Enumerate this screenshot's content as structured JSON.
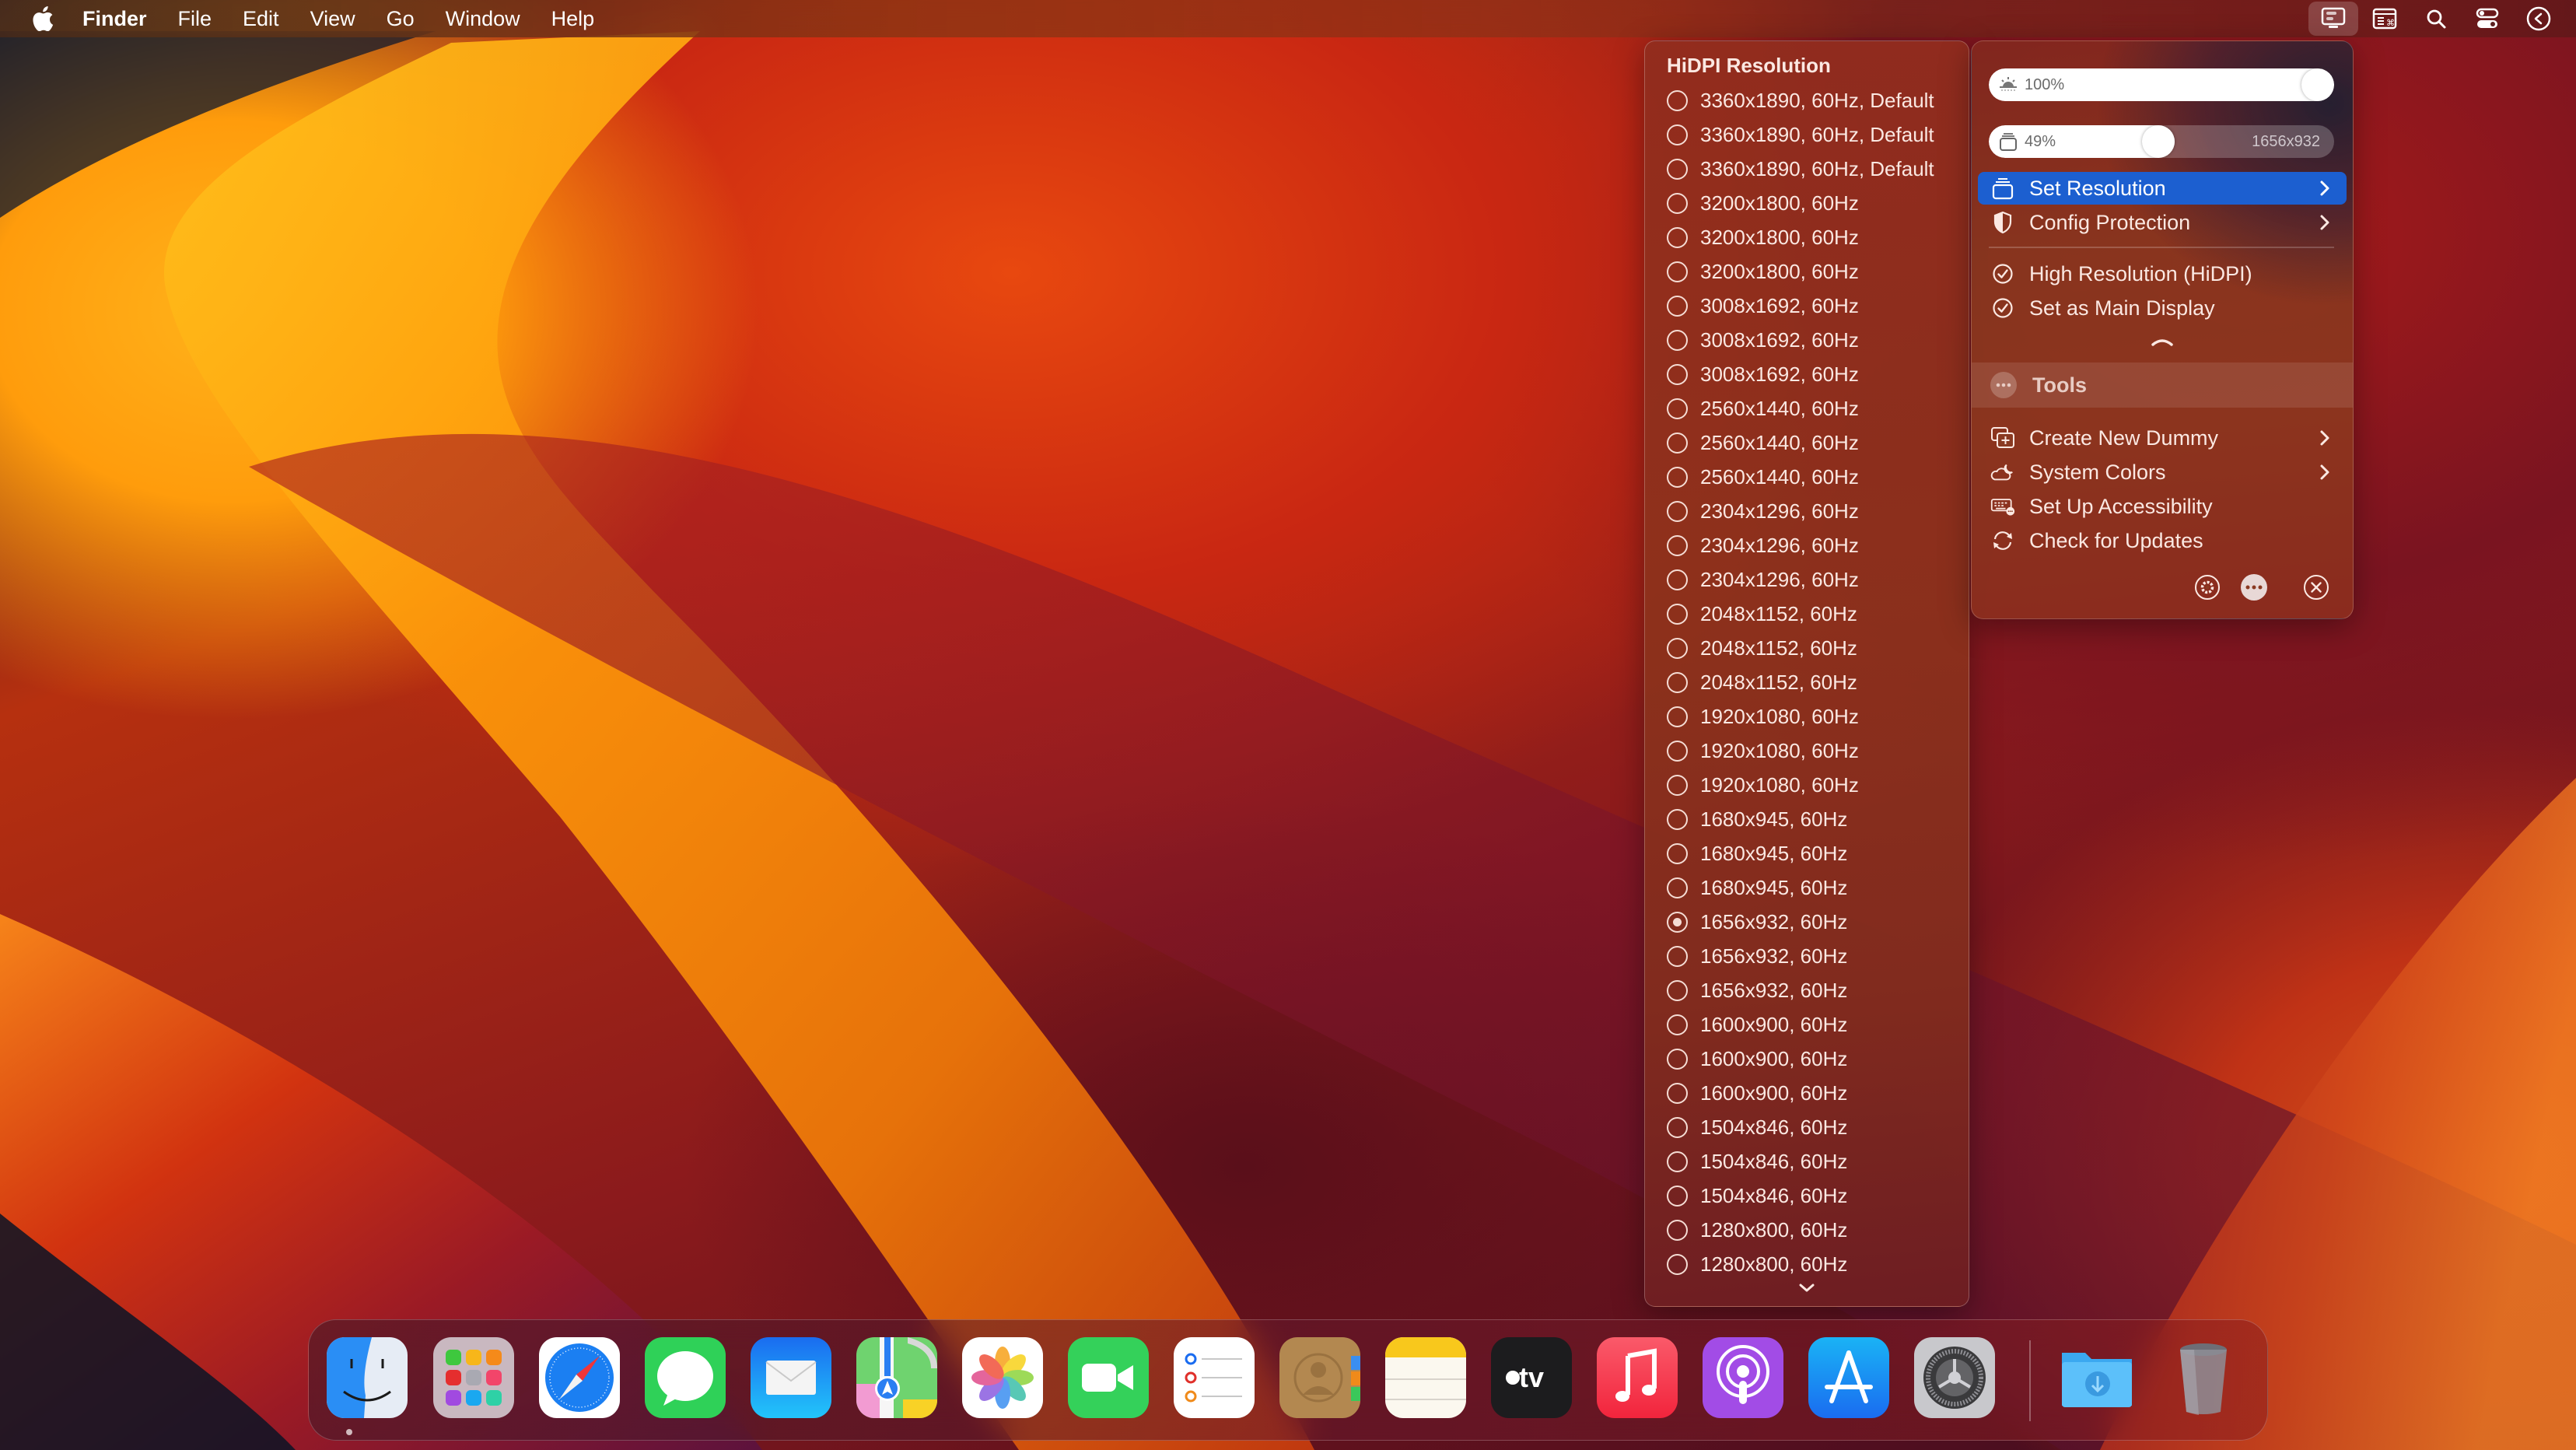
{
  "menubar": {
    "apple_icon": "apple-logo",
    "app_name": "Finder",
    "menus": [
      "File",
      "Edit",
      "View",
      "Go",
      "Window",
      "Help"
    ],
    "status_icons": [
      "display-settings-icon",
      "keyboard-shortcut-icon",
      "spotlight-search-icon",
      "control-center-icon",
      "collapse-arrow-icon"
    ]
  },
  "resolution_submenu": {
    "title": "HiDPI Resolution",
    "selected_index": 24,
    "items": [
      "3360x1890, 60Hz, Default",
      "3360x1890, 60Hz, Default",
      "3360x1890, 60Hz, Default",
      "3200x1800, 60Hz",
      "3200x1800, 60Hz",
      "3200x1800, 60Hz",
      "3008x1692, 60Hz",
      "3008x1692, 60Hz",
      "3008x1692, 60Hz",
      "2560x1440, 60Hz",
      "2560x1440, 60Hz",
      "2560x1440, 60Hz",
      "2304x1296, 60Hz",
      "2304x1296, 60Hz",
      "2304x1296, 60Hz",
      "2048x1152, 60Hz",
      "2048x1152, 60Hz",
      "2048x1152, 60Hz",
      "1920x1080, 60Hz",
      "1920x1080, 60Hz",
      "1920x1080, 60Hz",
      "1680x945, 60Hz",
      "1680x945, 60Hz",
      "1680x945, 60Hz",
      "1656x932, 60Hz",
      "1656x932, 60Hz",
      "1656x932, 60Hz",
      "1600x900, 60Hz",
      "1600x900, 60Hz",
      "1600x900, 60Hz",
      "1504x846, 60Hz",
      "1504x846, 60Hz",
      "1504x846, 60Hz",
      "1280x800, 60Hz",
      "1280x800, 60Hz"
    ],
    "scroll_icon": "chevron-down-icon"
  },
  "panel": {
    "brightness": {
      "label": "100%",
      "value_percent": 100,
      "icon": "brightness-icon"
    },
    "resolution_slider": {
      "label": "49%",
      "value_percent": 49,
      "value_text": "1656x932",
      "icon": "display-stack-icon"
    },
    "items": [
      {
        "label": "Set Resolution",
        "icon": "display-stack-icon",
        "submenu": true,
        "highlighted": true
      },
      {
        "label": "Config Protection",
        "icon": "shield-icon",
        "submenu": true,
        "highlighted": false
      }
    ],
    "toggles": [
      {
        "label": "High Resolution (HiDPI)",
        "checked": true
      },
      {
        "label": "Set as Main Display",
        "checked": true
      }
    ],
    "tools_header": "Tools",
    "tools": [
      {
        "label": "Create New Dummy",
        "icon": "add-display-icon",
        "submenu": true
      },
      {
        "label": "System Colors",
        "icon": "cloud-moon-icon",
        "submenu": true
      },
      {
        "label": "Set Up Accessibility",
        "icon": "keyboard-accessibility-icon",
        "submenu": false
      },
      {
        "label": "Check for Updates",
        "icon": "refresh-icon",
        "submenu": false
      }
    ],
    "footer": [
      "settings-icon",
      "more-icon",
      "quit-icon"
    ],
    "accent_color": "#1c5fd0"
  },
  "dock": {
    "apps": [
      "Finder",
      "Launchpad",
      "Safari",
      "Messages",
      "Mail",
      "Maps",
      "Photos",
      "FaceTime",
      "Reminders",
      "Contacts",
      "Notes",
      "TV",
      "Music",
      "Podcasts",
      "App Store",
      "System Settings"
    ],
    "running": [
      "Finder"
    ],
    "stacks": [
      "Downloads",
      "Trash"
    ]
  }
}
